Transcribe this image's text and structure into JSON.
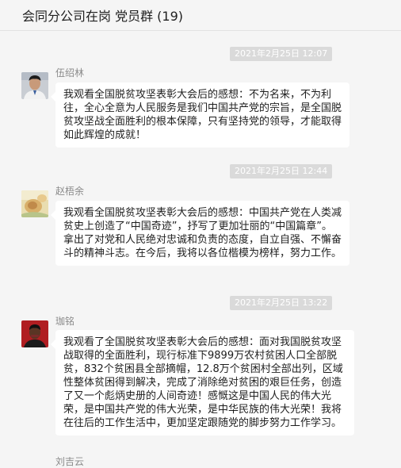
{
  "header": {
    "title": "会同分公司在岗 党员群 (19)"
  },
  "messages": [
    {
      "time": "2021年2月25日 12:07",
      "sender": "伍绍林",
      "avatar_icon": "man-portrait-avatar",
      "text": "我观看全国脱贫攻坚表彰大会后的感想：不为名来，不为利往，全心全意为人民服务是我们中国共产党的宗旨，是全国脱贫攻坚战全面胜利的根本保障，只有坚持党的领导，才能取得如此辉煌的成就！"
    },
    {
      "time": "2021年2月25日 12:44",
      "sender": "赵梧余",
      "avatar_icon": "flower-photo-avatar",
      "text": "我观看全国脱贫攻坚表彰大会后的感想：中国共产党在人类减贫史上创造了“中国奇迹”，抒写了更加壮丽的“中国篇章”。拿出了对党和人民绝对忠诚和负责的态度，自立自强、不懈奋斗的精神斗志。在今后，我将以各位楷模为榜样，努力工作。"
    },
    {
      "time": "2021年2月25日 13:22",
      "sender": "珈铭",
      "avatar_icon": "red-background-portrait-avatar",
      "text": "我观看了全国脱贫攻坚表彰大会后的感想：面对我国脱贫攻坚战取得的全面胜利，现行标准下9899万农村贫困人口全部脱贫，832个贫困县全部摘帽，12.8万个贫困村全部出列，区域性整体贫困得到解决，完成了消除绝对贫困的艰巨任务，创造了又一个彪炳史册的人间奇迹！感慨这是中国人民的伟大光荣，是中国共产党的伟大光荣，是中华民族的伟大光荣！我将在往后的工作生活中，更加坚定跟随党的脚步努力工作学习。"
    },
    {
      "sender": "刘吉云"
    }
  ]
}
